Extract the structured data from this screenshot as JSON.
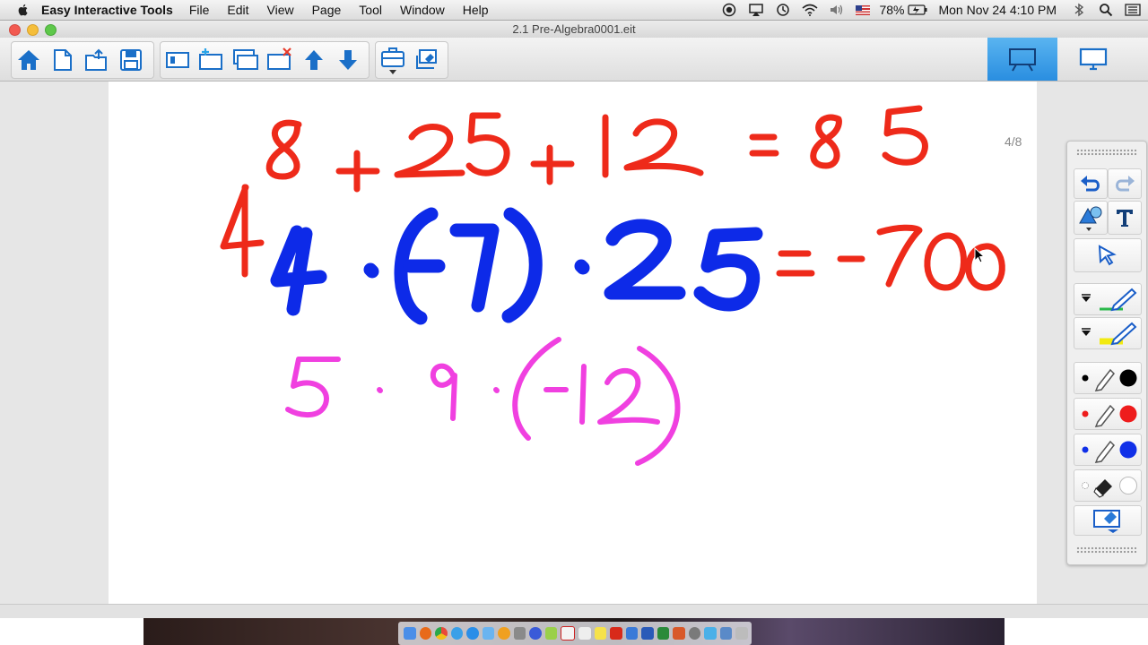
{
  "menubar": {
    "app_name": "Easy Interactive Tools",
    "items": [
      "File",
      "Edit",
      "View",
      "Page",
      "Tool",
      "Window",
      "Help"
    ],
    "battery": "78%",
    "clock": "Mon Nov 24  4:10 PM",
    "icons": [
      "record-icon",
      "airplay-icon",
      "time-machine-icon",
      "wifi-icon",
      "volume-icon",
      "flag-icon",
      "battery-icon",
      "bluetooth-icon",
      "spotlight-icon",
      "notification-icon"
    ]
  },
  "window": {
    "title": "2.1 Pre-Algebra0001.eit"
  },
  "toolbar": {
    "buttons": [
      "home-icon",
      "new-page-icon",
      "open-icon",
      "save-icon",
      "page-view-icon",
      "add-page-icon",
      "duplicate-page-icon",
      "delete-page-icon",
      "move-up-icon",
      "move-down-icon",
      "toolbox-icon",
      "capture-icon"
    ],
    "modes": [
      "whiteboard-mode-icon",
      "desktop-mode-icon"
    ]
  },
  "page": {
    "indicator": "4/8"
  },
  "ink": {
    "red": "#ee2a1a",
    "blue": "#0d2ae8",
    "magenta": "#f040e0"
  },
  "palette": {
    "tools": [
      "undo-icon",
      "redo-icon",
      "shapes-icon",
      "text-icon",
      "select-icon",
      "pen-green-icon",
      "highlighter-yellow-icon",
      "pen-black-icon",
      "pen-red-icon",
      "pen-blue-icon",
      "eraser-icon",
      "screen-capture-icon"
    ],
    "colors": {
      "black": "#000000",
      "red": "#ee1c1c",
      "blue": "#1030e8",
      "white": "#ffffff",
      "green": "#2ab84a",
      "yellow": "#f2ea10"
    }
  }
}
